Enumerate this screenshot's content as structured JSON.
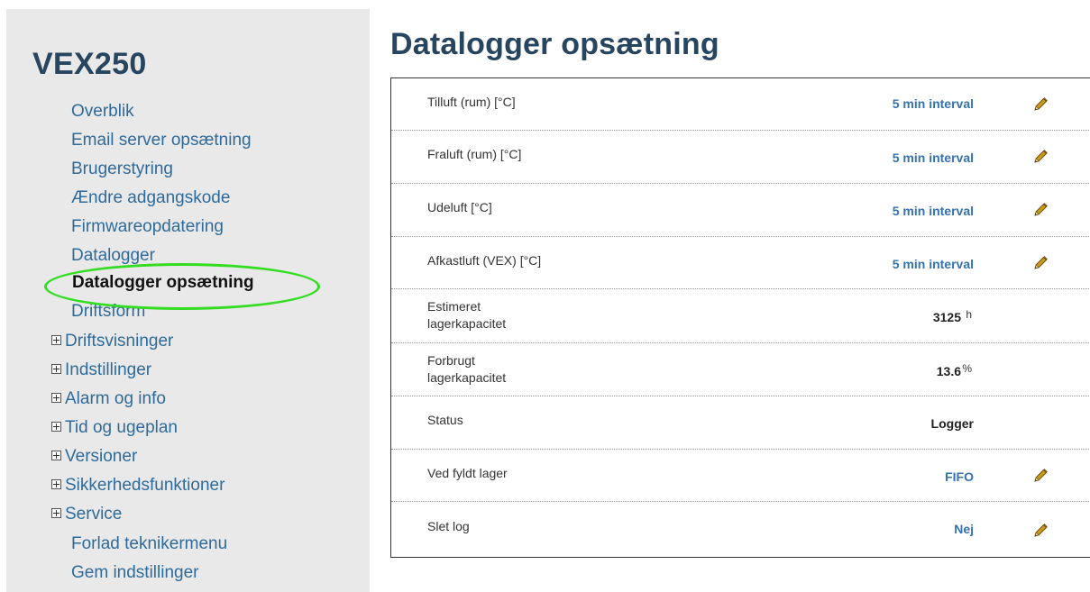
{
  "app": {
    "title": "VEX250"
  },
  "sidebar": {
    "items": [
      {
        "label": "Overblik",
        "expandable": false,
        "active": false
      },
      {
        "label": "Email server opsætning",
        "expandable": false,
        "active": false
      },
      {
        "label": "Brugerstyring",
        "expandable": false,
        "active": false
      },
      {
        "label": "Ændre adgangskode",
        "expandable": false,
        "active": false
      },
      {
        "label": "Firmwareopdatering",
        "expandable": false,
        "active": false
      },
      {
        "label": "Datalogger",
        "expandable": false,
        "active": false
      },
      {
        "label": "Datalogger opsætning",
        "expandable": false,
        "active": true
      },
      {
        "label": "Driftsform",
        "expandable": false,
        "active": false
      },
      {
        "label": "Driftsvisninger",
        "expandable": true,
        "active": false
      },
      {
        "label": "Indstillinger",
        "expandable": true,
        "active": false
      },
      {
        "label": "Alarm og info",
        "expandable": true,
        "active": false
      },
      {
        "label": "Tid og ugeplan",
        "expandable": true,
        "active": false
      },
      {
        "label": "Versioner",
        "expandable": true,
        "active": false
      },
      {
        "label": "Sikkerhedsfunktioner",
        "expandable": true,
        "active": false
      },
      {
        "label": "Service",
        "expandable": true,
        "active": false
      },
      {
        "label": "Forlad teknikermenu",
        "expandable": false,
        "active": false
      },
      {
        "label": "Gem indstillinger",
        "expandable": false,
        "active": false
      }
    ]
  },
  "page": {
    "title": "Datalogger opsætning"
  },
  "settings": [
    {
      "label_lines": [
        "Tilluft (rum) [°C]"
      ],
      "value": "5 min interval",
      "unit": "",
      "editable": true
    },
    {
      "label_lines": [
        "Fraluft (rum) [°C]"
      ],
      "value": "5 min interval",
      "unit": "",
      "editable": true
    },
    {
      "label_lines": [
        "Udeluft [°C]"
      ],
      "value": "5 min interval",
      "unit": "",
      "editable": true
    },
    {
      "label_lines": [
        "Afkastluft (VEX) [°C]"
      ],
      "value": "5 min interval",
      "unit": "",
      "editable": true
    },
    {
      "label_lines": [
        "Estimeret",
        "lagerkapacitet"
      ],
      "value": "3125",
      "unit": "h",
      "editable": false
    },
    {
      "label_lines": [
        "Forbrugt",
        "lagerkapacitet"
      ],
      "value": "13.6",
      "unit": "%",
      "editable": false
    },
    {
      "label_lines": [
        "Status"
      ],
      "value": "Logger",
      "unit": "",
      "editable": false
    },
    {
      "label_lines": [
        "Ved fyldt lager"
      ],
      "value": "FIFO",
      "unit": "",
      "editable": true
    },
    {
      "label_lines": [
        "Slet log"
      ],
      "value": "Nej",
      "unit": "",
      "editable": true
    }
  ],
  "icons": {
    "edit": "pencil-icon",
    "expand": "plus-box-icon"
  },
  "colors": {
    "highlight": "#33dd22",
    "link": "#2f6b9a",
    "value": "#3572b0",
    "title": "#28455f"
  }
}
